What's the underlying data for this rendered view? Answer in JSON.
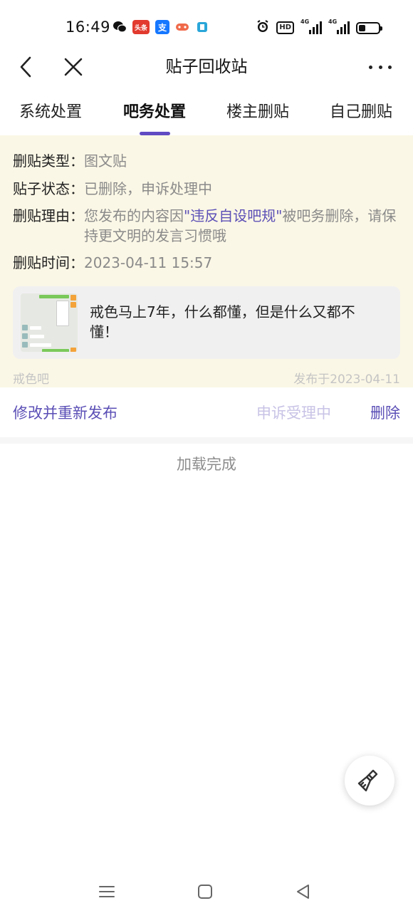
{
  "status_bar": {
    "time": "16:49",
    "apps": [
      {
        "icon": "wechat-icon",
        "label": ""
      },
      {
        "icon": "toutiao-icon",
        "label": "头条"
      },
      {
        "icon": "alipay-icon",
        "label": "支"
      },
      {
        "icon": "game-icon",
        "label": ""
      },
      {
        "icon": "film-icon",
        "label": ""
      }
    ],
    "hd_label": "HD",
    "network": [
      "4G",
      "4G"
    ],
    "battery_level": 0.35
  },
  "nav": {
    "title": "贴子回收站"
  },
  "tabs": [
    {
      "label": "系统处置",
      "active": false
    },
    {
      "label": "吧务处置",
      "active": true
    },
    {
      "label": "楼主删贴",
      "active": false
    },
    {
      "label": "自己删贴",
      "active": false
    }
  ],
  "detail": {
    "type_label": "删贴类型：",
    "type_value": "图文贴",
    "status_label": "贴子状态：",
    "status_value": "已删除，申诉处理中",
    "reason_label": "删贴理由：",
    "reason_prefix": "您发布的内容因",
    "reason_highlight": "\"违反自设吧规\"",
    "reason_suffix": "被吧务删除，请保持更文明的发言习惯哦",
    "time_label": "删贴时间：",
    "time_value": "2023-04-11 15:57"
  },
  "post": {
    "title": "戒色马上7年，什么都懂，但是什么又都不懂！",
    "forum": "戒色吧",
    "published": "发布于2023-04-11"
  },
  "actions": {
    "edit_label": "修改并重新发布",
    "appeal_label": "申诉受理中",
    "delete_label": "删除"
  },
  "footer": {
    "load_done": "加载完成"
  },
  "colors": {
    "accent": "#614bc3",
    "card_bg": "#fbf7e6"
  }
}
